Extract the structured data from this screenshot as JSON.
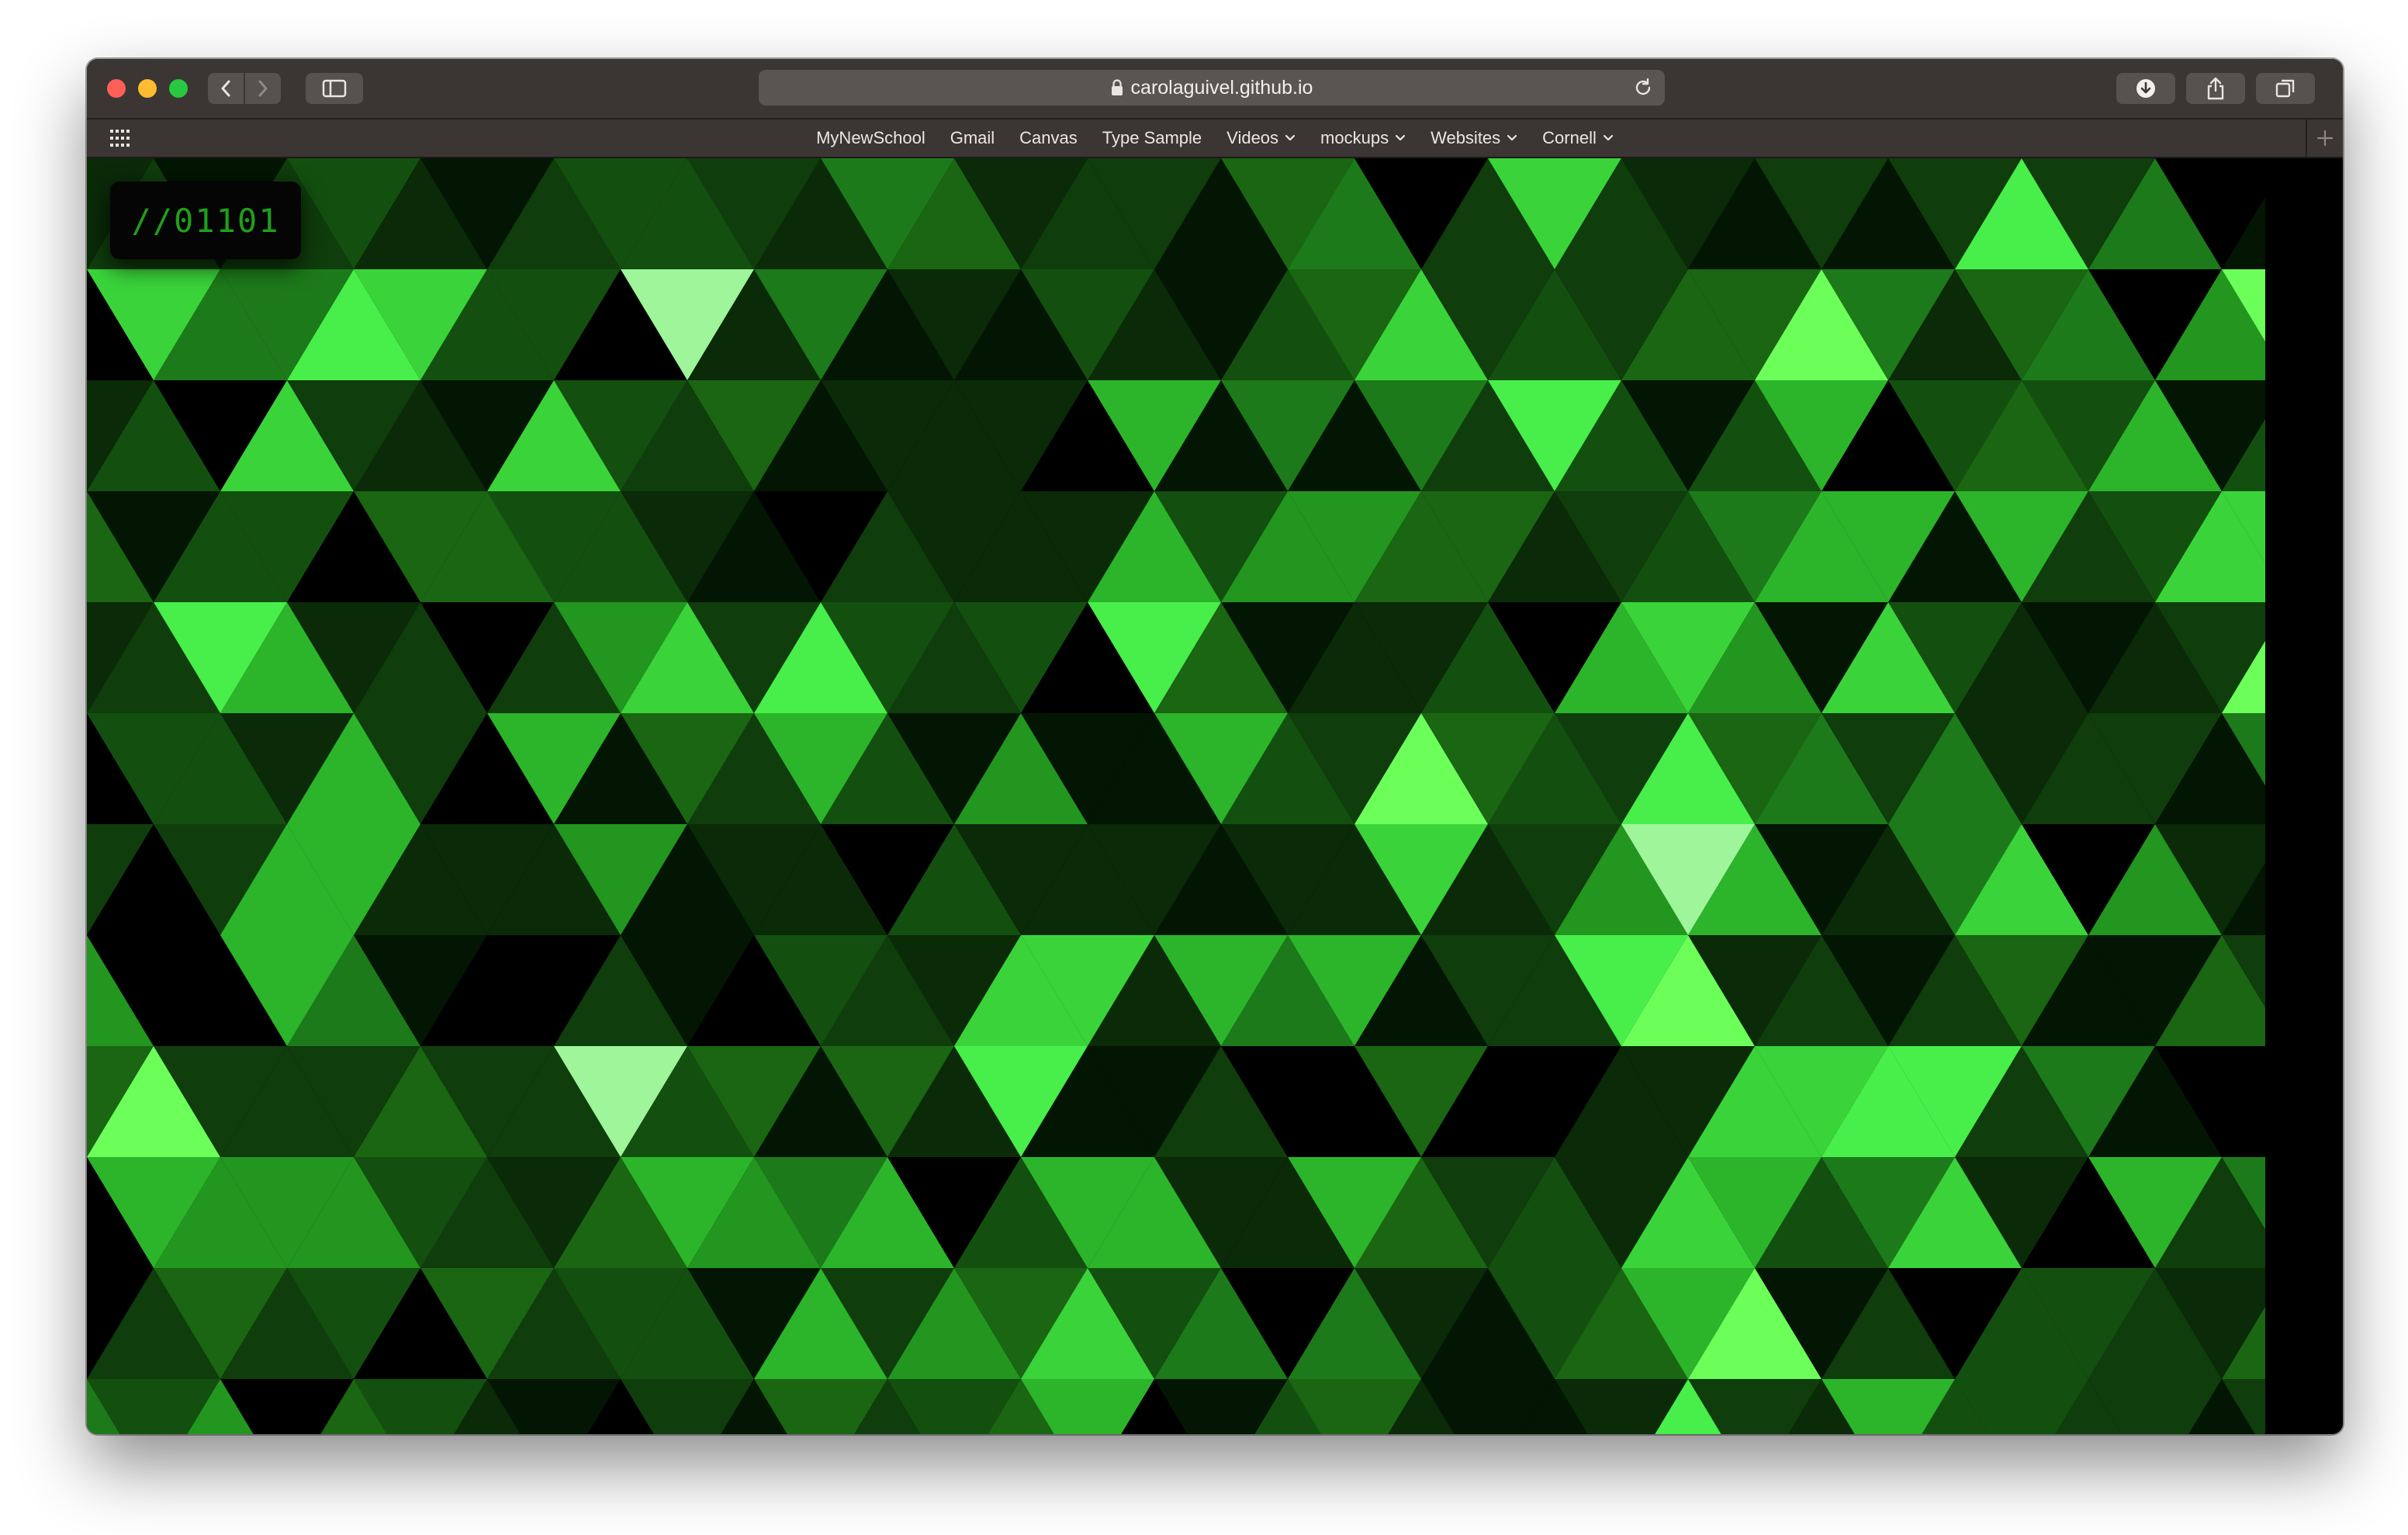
{
  "browser": {
    "url": "carolaguivel.github.io"
  },
  "bookmarks": {
    "items": [
      {
        "label": "MyNewSchool",
        "dropdown": false
      },
      {
        "label": "Gmail",
        "dropdown": false
      },
      {
        "label": "Canvas",
        "dropdown": false
      },
      {
        "label": "Type Sample",
        "dropdown": false
      },
      {
        "label": "Videos",
        "dropdown": true
      },
      {
        "label": "mockups",
        "dropdown": true
      },
      {
        "label": "Websites",
        "dropdown": true
      },
      {
        "label": "Cornell",
        "dropdown": true
      }
    ]
  },
  "page": {
    "logo_text": "//01101",
    "palette": [
      "#000000",
      "#031503",
      "#0a2a08",
      "#0f3d0c",
      "#13500f",
      "#1a6612",
      "#1d7a1a",
      "#22961f",
      "#2cb52a",
      "#3ad43a",
      "#48ef4a",
      "#6cff5a",
      "#9ef59a"
    ]
  },
  "icons": {
    "traffic_lights": [
      "close-icon",
      "minimize-icon",
      "maximize-icon"
    ],
    "toolbar": [
      "back-icon",
      "forward-icon",
      "sidebar-icon",
      "lock-icon",
      "reload-icon",
      "download-icon",
      "share-icon",
      "tabs-overview-icon",
      "apps-grid-icon",
      "new-tab-plus-icon"
    ]
  }
}
